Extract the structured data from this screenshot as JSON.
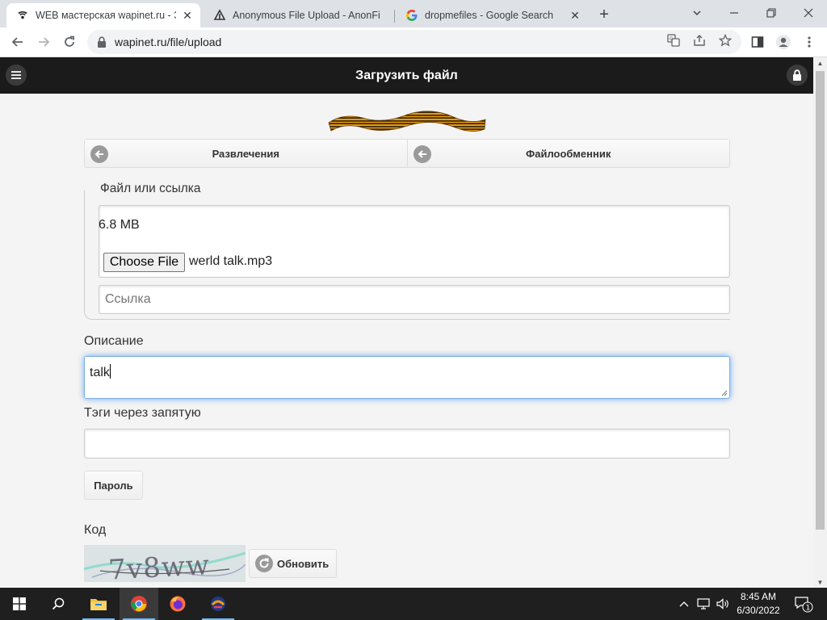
{
  "browser": {
    "tabs": [
      {
        "title": "WEB мастерская wapinet.ru - За",
        "active": true
      },
      {
        "title": "Anonymous File Upload - AnonFi",
        "active": false
      },
      {
        "title": "dropmefiles - Google Search",
        "active": false
      }
    ],
    "url": "wapinet.ru/file/upload"
  },
  "site": {
    "title": "Загрузить файл",
    "nav": {
      "left": "Развлечения",
      "right": "Файлообменник"
    }
  },
  "form": {
    "file_legend": "Файл или ссылка",
    "file_size": "6.8 MB",
    "choose_file_label": "Choose File",
    "file_name": "werld talk.mp3",
    "link_placeholder": "Ссылка",
    "description_label": "Описание",
    "description_value": "talk",
    "tags_label": "Тэги через запятую",
    "tags_value": "",
    "password_button": "Пароль",
    "code_label": "Код",
    "captcha_text": "7v8ww",
    "refresh_button": "Обновить"
  },
  "taskbar": {
    "time": "8:45 AM",
    "date": "6/30/2022",
    "notification_count": "1"
  },
  "colors": {
    "site_header": "#1b1b1b",
    "page_bg": "#f4f4f4",
    "focus_glow": "#388ef0",
    "taskbar": "#1f1f1f"
  }
}
